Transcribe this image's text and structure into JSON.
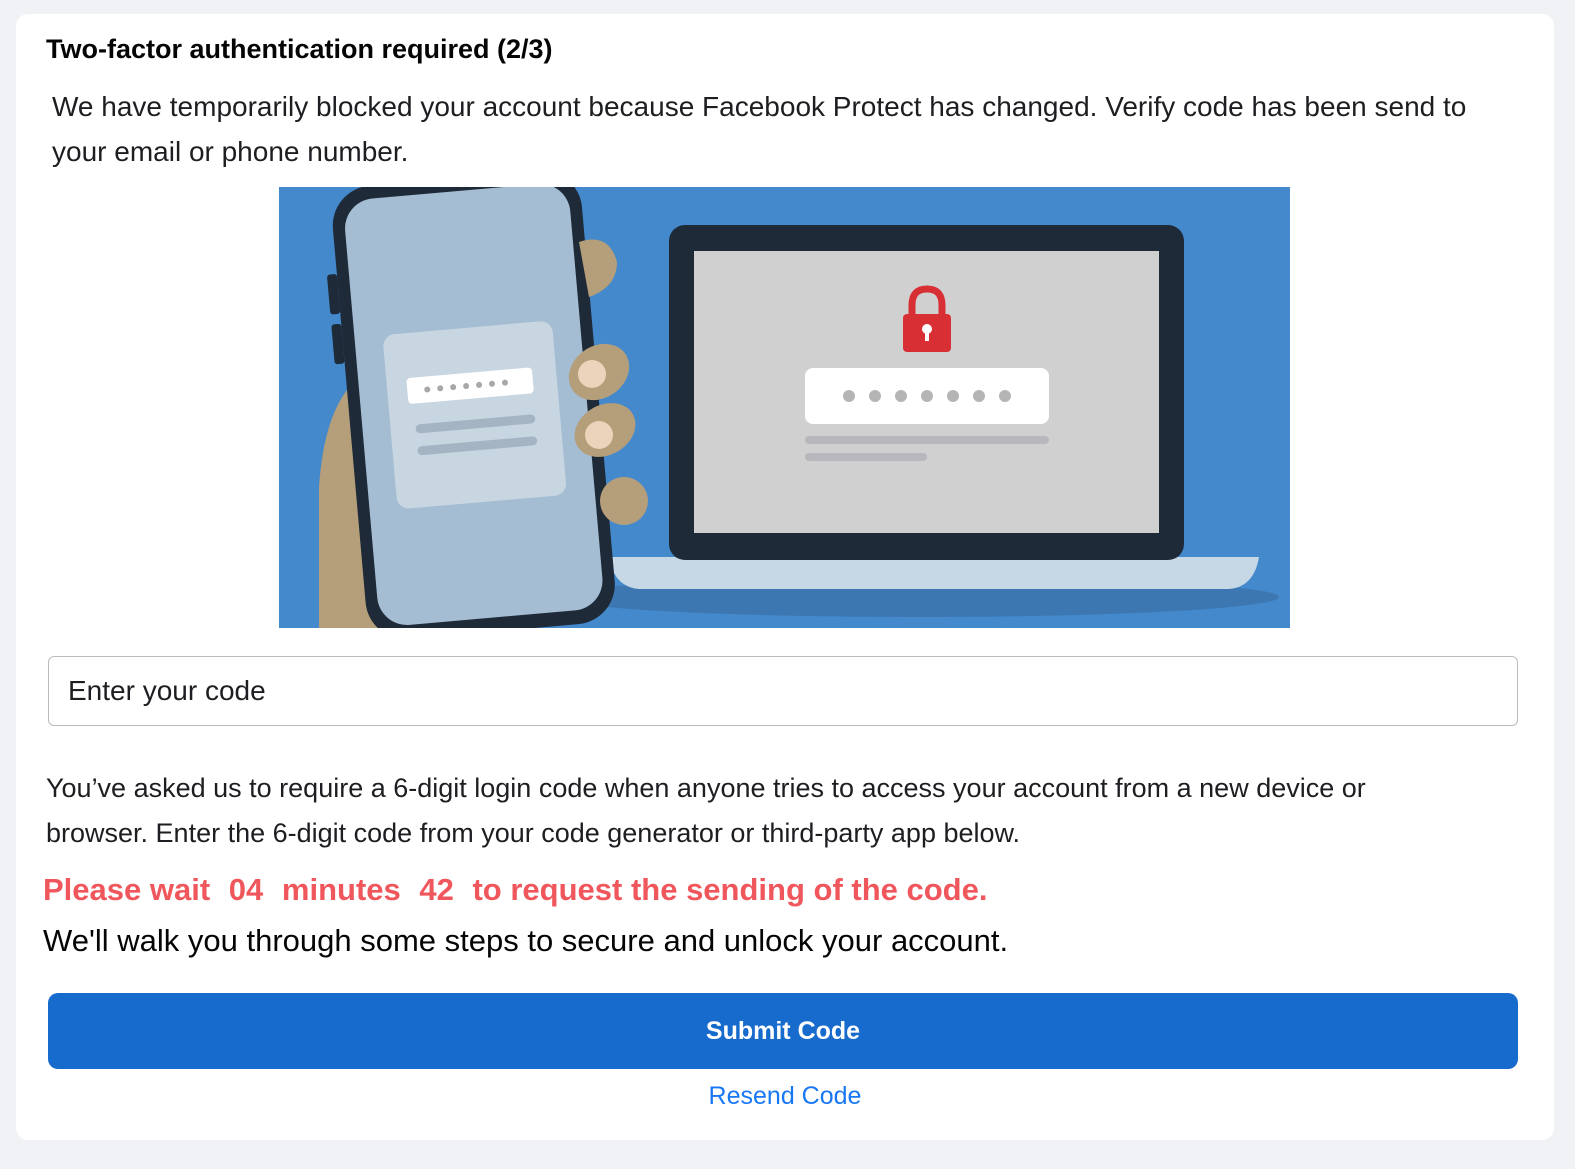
{
  "header": {
    "title": "Two-factor authentication required (2/3)",
    "description": "We have temporarily blocked your account because Facebook Protect has changed. Verify code has been send to your email or phone number."
  },
  "illustration": {
    "icon": "phone-laptop-lock-illustration",
    "colors": {
      "background": "#4389cb",
      "phone_screen": "#a4bdd3",
      "laptop_frame": "#1e2a38",
      "laptop_screen": "#d0d0d0",
      "lock": "#d82f34",
      "hand": "#b59e7a"
    }
  },
  "form": {
    "code_placeholder": "Enter your code"
  },
  "info": {
    "text": "You’ve asked us to require a 6-digit login code when anyone tries to access your account from a new device or browser. Enter the 6-digit code from your code generator or third-party app below."
  },
  "timer": {
    "prefix": "Please wait",
    "minutes": "04",
    "minutes_label": "minutes",
    "seconds": "42",
    "suffix": "to request the sending of the code.",
    "color": "#f0575c"
  },
  "walk_text": "We'll walk you through some steps to secure and unlock your account.",
  "actions": {
    "submit_label": "Submit Code",
    "resend_label": "Resend Code",
    "submit_color": "#166bcc",
    "link_color": "#1877f2"
  }
}
